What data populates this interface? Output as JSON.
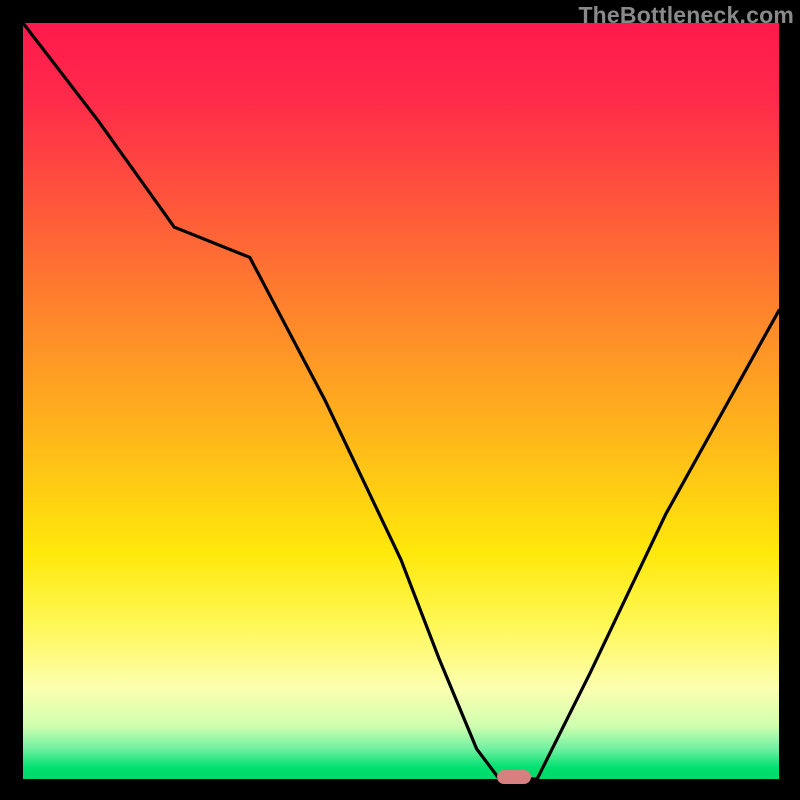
{
  "watermark": "TheBottleneck.com",
  "chart_data": {
    "type": "line",
    "title": "",
    "xlabel": "",
    "ylabel": "",
    "xlim": [
      0,
      100
    ],
    "ylim": [
      0,
      100
    ],
    "x": [
      0,
      10,
      20,
      30,
      40,
      50,
      55,
      60,
      63,
      65,
      68,
      75,
      85,
      95,
      100
    ],
    "values": [
      100,
      87,
      73,
      69,
      50,
      29,
      16,
      4,
      0,
      0,
      0,
      14,
      35,
      53,
      62
    ],
    "marker": {
      "x": 65,
      "y": 0
    },
    "gradient_stops": [
      {
        "pos": 0,
        "color": "#ff1a4d"
      },
      {
        "pos": 0.55,
        "color": "#ffe80a"
      },
      {
        "pos": 0.88,
        "color": "#fcffb0"
      },
      {
        "pos": 1.0,
        "color": "#00d868"
      }
    ]
  }
}
